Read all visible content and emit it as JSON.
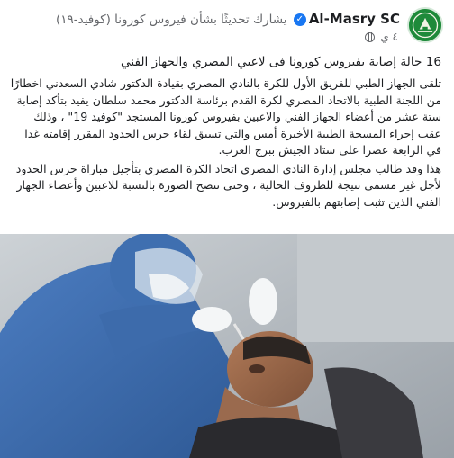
{
  "header": {
    "page_name": "Al-Masry SC",
    "action_text": "يشارك تحديثًا بشأن فيروس كورونا (كوفيد-١٩)",
    "time_label": "٤ ي",
    "verified_mark": "✓"
  },
  "post": {
    "headline": "16 حالة إصابة بفيروس كورونا فى لاعبي المصري والجهاز الفني",
    "paragraph1": "تلقى الجهاز الطبي للفريق الأول للكرة بالنادي المصري بقيادة الدكتور شادي السعدني اخطارًا من اللجنة الطبية بالاتحاد المصري لكرة القدم برئاسة الدكتور محمد سلطان يفيد بتأكد إصابة ستة عشر من أعضاء الجهاز الفني والاعبين بفيروس كورونا المستجد \"كوفيد 19\" ، وذلك عقب إجراء المسحة الطبية الأخيرة أمس والتي تسبق لقاء حرس الحدود المقرر إقامته غدا في الرابعة عصرا على ستاد الجيش ببرج العرب.",
    "paragraph2": "هذا وقد طالب مجلس إدارة النادي المصري اتحاد الكرة المصري بتأجيل مباراة حرس الحدود لأجل غير مسمى نتيجة للظروف الحالية ، وحتى تتضح الصورة بالنسبة للاعبين وأعضاء الجهاز الفني الذين تثبت إصابتهم بالفيروس."
  },
  "colors": {
    "verified": "#1877f2",
    "avatar": "#1e8a3a",
    "scrubs": "#3f6fb0",
    "muted_text": "#65676b"
  },
  "icons": [
    "club-logo-icon",
    "verified-badge-icon",
    "globe-icon"
  ]
}
